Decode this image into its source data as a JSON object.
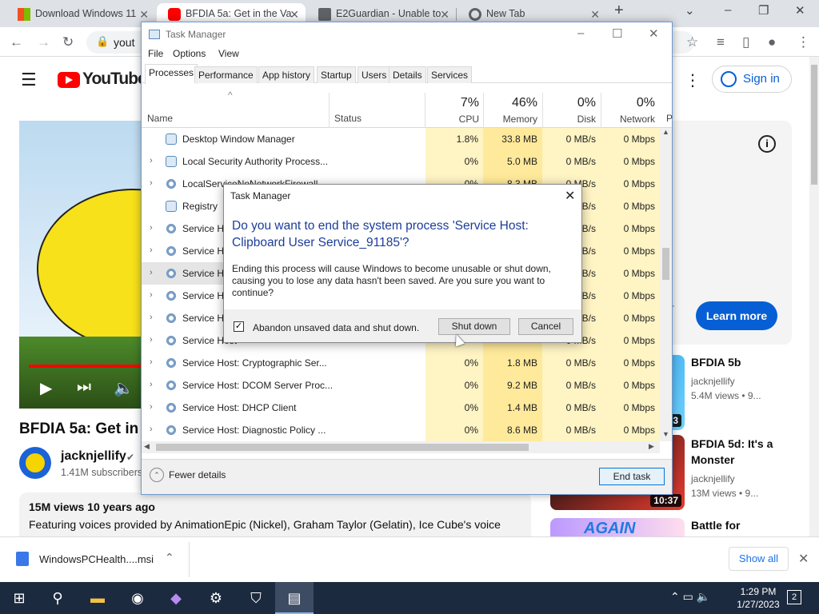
{
  "browser": {
    "tabs": [
      {
        "title": "Download Windows 11",
        "active": false
      },
      {
        "title": "BFDIA 5a: Get in the Va",
        "active": true
      },
      {
        "title": "E2Guardian - Unable to",
        "active": false
      },
      {
        "title": "New Tab",
        "active": false
      }
    ],
    "url": "yout"
  },
  "youtube": {
    "logo_text": "YouTube",
    "sign_in": "Sign in",
    "video_title": "BFDIA 5a: Get in th",
    "channel_name": "jacknjellify",
    "subscribers": "1.41M subscribers",
    "views_line": "15M views  10 years ago",
    "description": "Featuring voices provided by AnimationEpic (Nickel), Graham Taylor (Gelatin), Ice Cube's voice",
    "ad_button": "Learn more",
    "recommendations": [
      {
        "title": "BFDIA 5b",
        "channel": "jacknjellify",
        "meta": "5.4M views  • 9...",
        "duration": "3"
      },
      {
        "title": "BFDIA 5d: It's a Monster",
        "channel": "jacknjellify",
        "meta": "13M views  • 9...",
        "duration": "10:37"
      },
      {
        "title": "Battle for",
        "channel": "",
        "meta": "",
        "duration": ""
      }
    ],
    "recommendation_3_thumb_text": "AGAIN"
  },
  "downloads": {
    "file_name": "WindowsPCHealth....msi",
    "show_all": "Show all"
  },
  "taskbar": {
    "time": "1:29 PM",
    "date": "1/27/2023",
    "notifications": "2"
  },
  "task_manager": {
    "title": "Task Manager",
    "menu": [
      "File",
      "Options",
      "View"
    ],
    "tabs": [
      "Processes",
      "Performance",
      "App history",
      "Startup",
      "Users",
      "Details",
      "Services"
    ],
    "active_tab": "Processes",
    "columns": {
      "name": "Name",
      "status": "Status",
      "cpu": {
        "pct": "7%",
        "label": "CPU"
      },
      "memory": {
        "pct": "46%",
        "label": "Memory"
      },
      "disk": {
        "pct": "0%",
        "label": "Disk"
      },
      "network": {
        "pct": "0%",
        "label": "Network"
      },
      "power_partial": "P"
    },
    "rows": [
      {
        "name": "Desktop Window Manager",
        "icon": "window",
        "expand": false,
        "cpu": "1.8%",
        "mem": "33.8 MB",
        "disk": "0 MB/s",
        "net": "0 Mbps"
      },
      {
        "name": "Local Security Authority Process...",
        "icon": "window",
        "expand": true,
        "cpu": "0%",
        "mem": "5.0 MB",
        "disk": "0 MB/s",
        "net": "0 Mbps"
      },
      {
        "name": "LocalServiceNoNetworkFirewall...",
        "icon": "gear",
        "expand": true,
        "cpu": "0%",
        "mem": "8.3 MB",
        "disk": "0 MB/s",
        "net": "0 Mbps"
      },
      {
        "name": "Registry",
        "icon": "window",
        "expand": false,
        "cpu": "",
        "mem": "",
        "disk": "0 MB/s",
        "net": "0 Mbps"
      },
      {
        "name": "Service Host",
        "icon": "gear",
        "expand": true,
        "cpu": "",
        "mem": "",
        "disk": "0 MB/s",
        "net": "0 Mbps"
      },
      {
        "name": "Service Host",
        "icon": "gear",
        "expand": true,
        "cpu": "",
        "mem": "",
        "disk": "0 MB/s",
        "net": "0 Mbps"
      },
      {
        "name": "Service Host",
        "icon": "gear",
        "expand": true,
        "cpu": "",
        "mem": "",
        "disk": "0 MB/s",
        "net": "0 Mbps",
        "selected": true
      },
      {
        "name": "Service Host",
        "icon": "gear",
        "expand": true,
        "cpu": "",
        "mem": "",
        "disk": "0 MB/s",
        "net": "0 Mbps"
      },
      {
        "name": "Service Host",
        "icon": "gear",
        "expand": true,
        "cpu": "",
        "mem": "",
        "disk": "0 MB/s",
        "net": "0 Mbps"
      },
      {
        "name": "Service Host",
        "icon": "gear",
        "expand": true,
        "cpu": "",
        "mem": "",
        "disk": "0 MB/s",
        "net": "0 Mbps"
      },
      {
        "name": "Service Host: Cryptographic Ser...",
        "icon": "gear",
        "expand": true,
        "cpu": "0%",
        "mem": "1.8 MB",
        "disk": "0 MB/s",
        "net": "0 Mbps"
      },
      {
        "name": "Service Host: DCOM Server Proc...",
        "icon": "gear",
        "expand": true,
        "cpu": "0%",
        "mem": "9.2 MB",
        "disk": "0 MB/s",
        "net": "0 Mbps"
      },
      {
        "name": "Service Host: DHCP Client",
        "icon": "gear",
        "expand": true,
        "cpu": "0%",
        "mem": "1.4 MB",
        "disk": "0 MB/s",
        "net": "0 Mbps"
      },
      {
        "name": "Service Host: Diagnostic Policy ...",
        "icon": "gear",
        "expand": true,
        "cpu": "0%",
        "mem": "8.6 MB",
        "disk": "0 MB/s",
        "net": "0 Mbps"
      }
    ],
    "fewer_details": "Fewer details",
    "end_task": "End task"
  },
  "dialog": {
    "title": "Task Manager",
    "heading": "Do you want to end the system process 'Service Host: Clipboard User Service_91185'?",
    "body": "Ending this process will cause Windows to become unusable or shut down, causing you to lose any data hasn't been saved. Are you sure you want to continue?",
    "checkbox_label": "Abandon unsaved data and shut down.",
    "checkbox_checked": true,
    "shut_down": "Shut down",
    "cancel": "Cancel"
  },
  "colors": {
    "youtube_red": "#ff0000",
    "link_blue": "#065fd4",
    "dialog_heading": "#1c3d9a",
    "heat_light": "#fff4c4",
    "heat_memory": "#ffe99a",
    "taskbar": "#1c2a3f"
  }
}
